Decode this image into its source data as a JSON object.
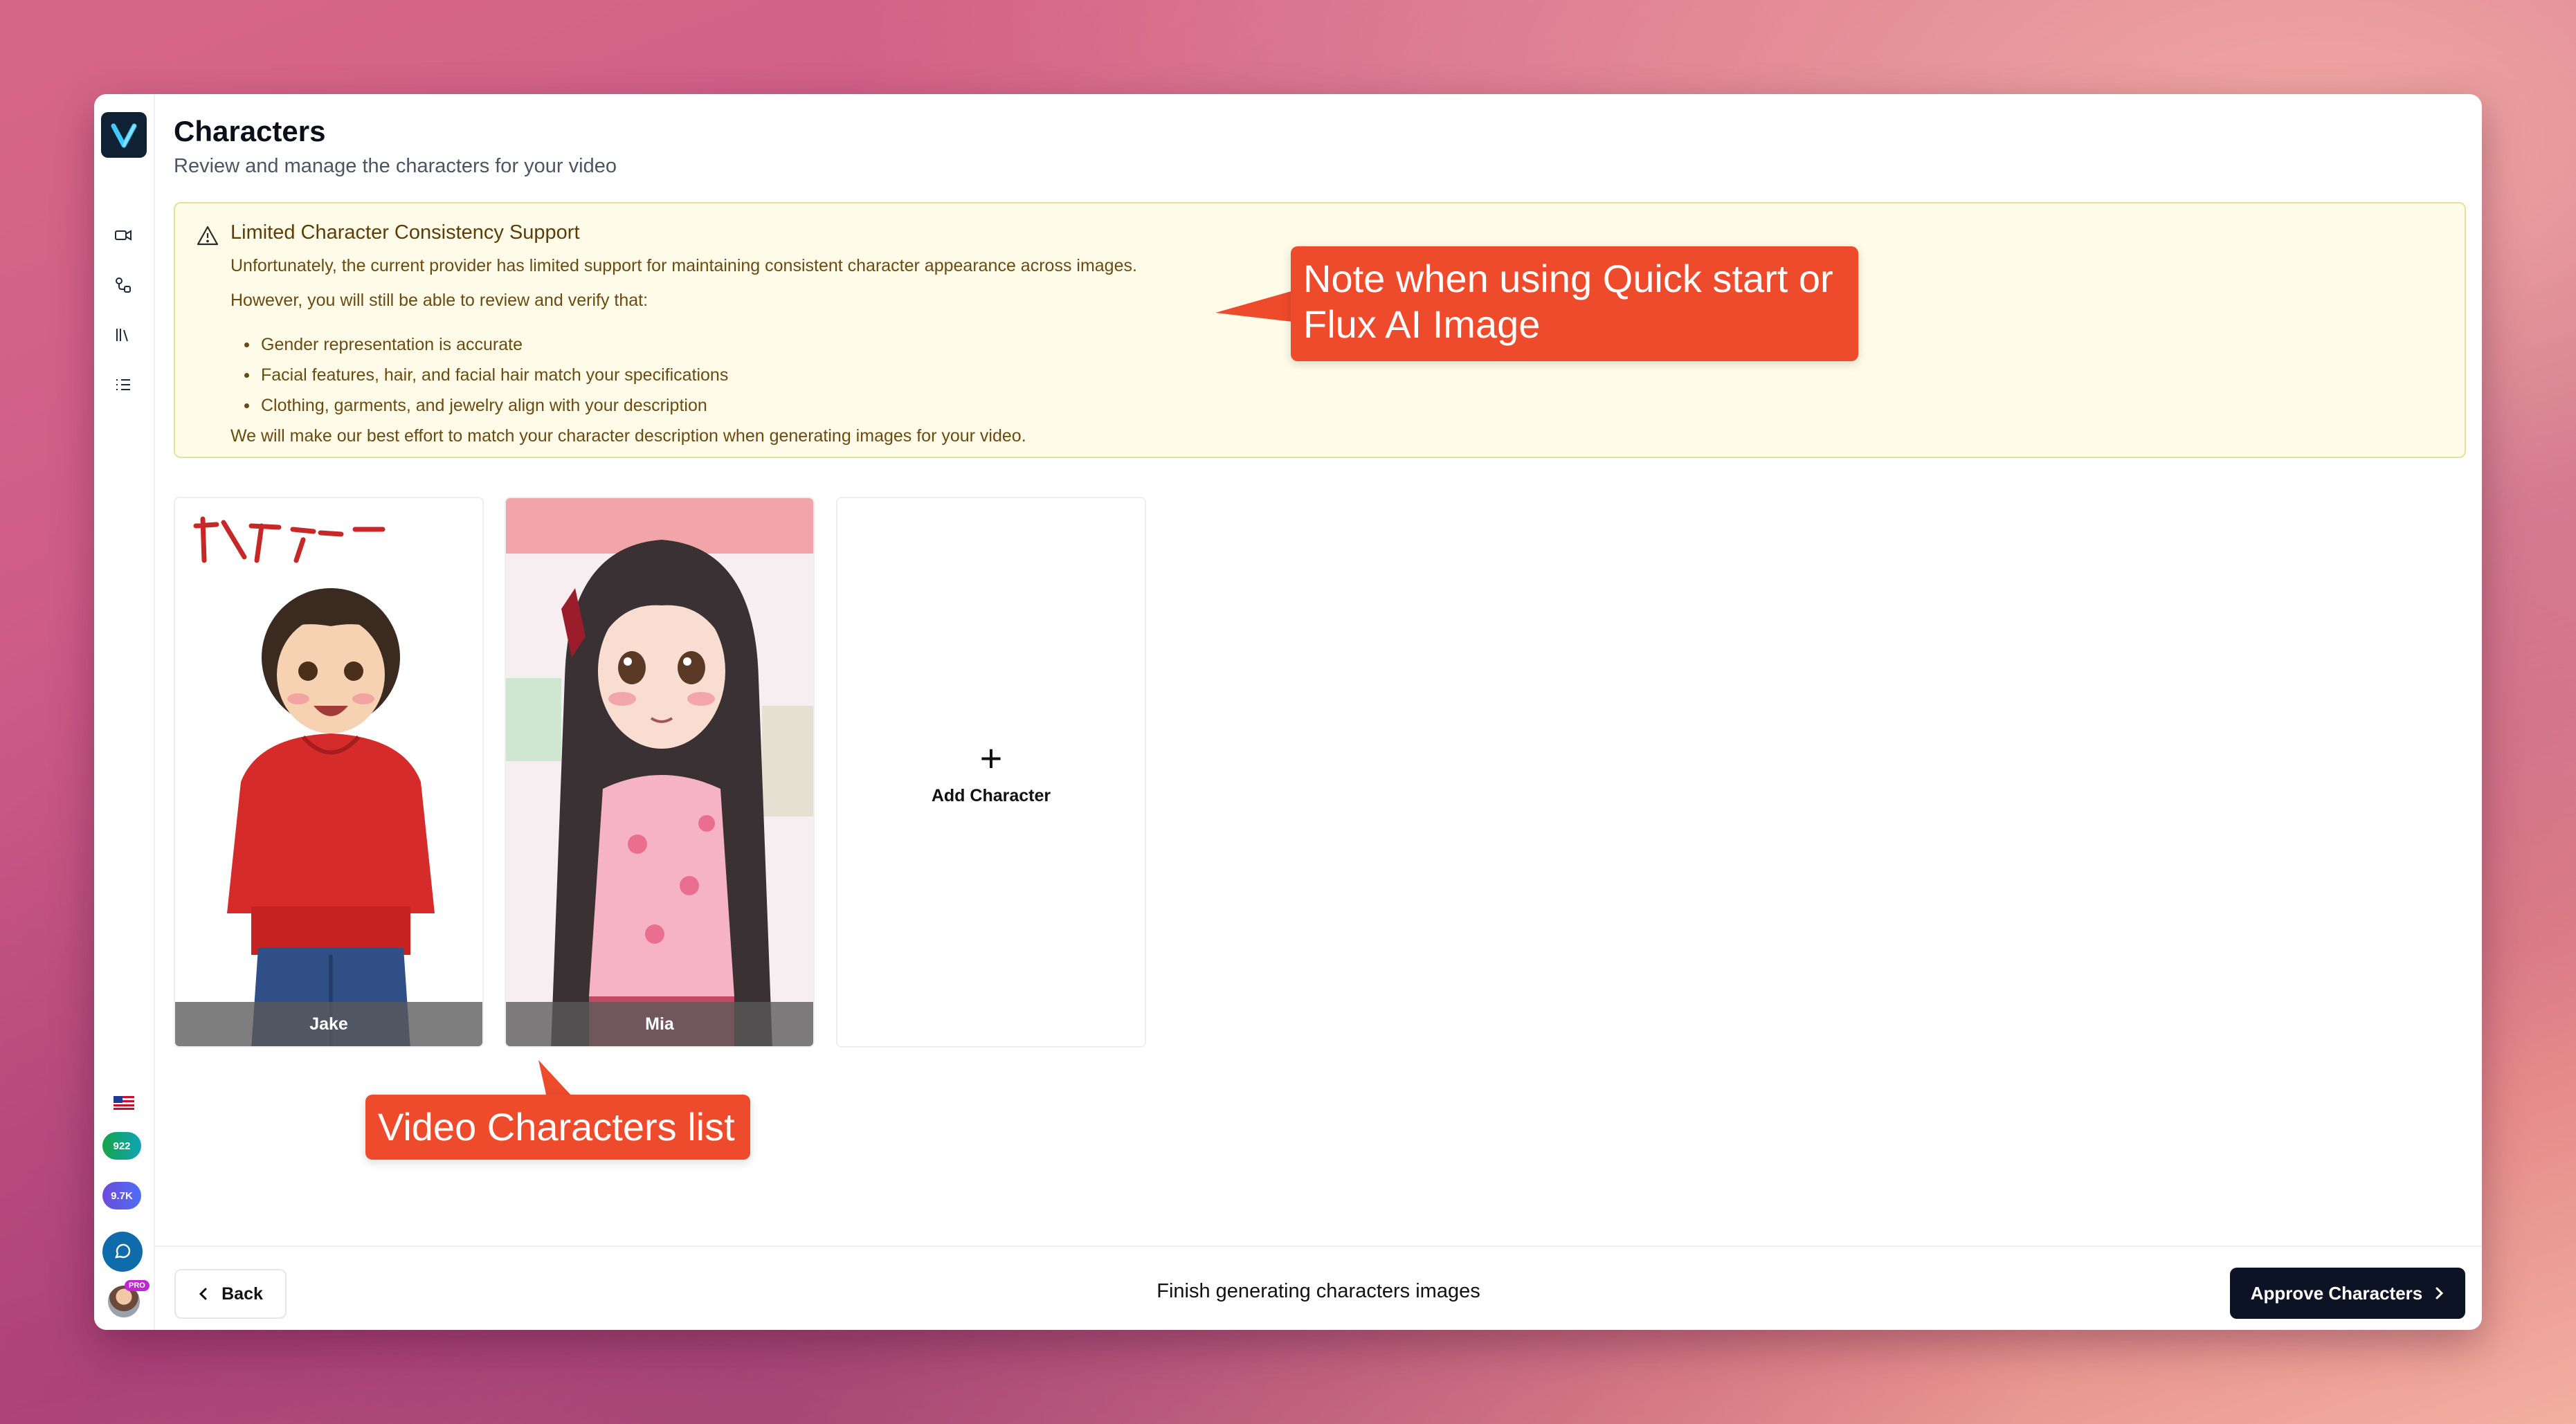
{
  "header": {
    "title": "Characters",
    "subtitle": "Review and manage the characters for your video"
  },
  "sidebar": {
    "items": [
      {
        "name": "video-icon"
      },
      {
        "name": "workflow-icon"
      },
      {
        "name": "library-icon"
      },
      {
        "name": "list-icon"
      }
    ],
    "credits_1": "922",
    "credits_2": "9.7K",
    "pro_label": "PRO"
  },
  "alert": {
    "title": "Limited Character Consistency Support",
    "line1": "Unfortunately, the current provider has limited support for maintaining consistent character appearance across images.",
    "line2": "However, you will still be able to review and verify that:",
    "bullets": [
      "Gender representation is accurate",
      "Facial features, hair, and facial hair match your specifications",
      "Clothing, garments, and jewelry align with your description"
    ],
    "line3": "We will make our best effort to match your character description when generating images for your video."
  },
  "characters": [
    {
      "name": "Jake"
    },
    {
      "name": "Mia"
    }
  ],
  "add_character_label": "Add Character",
  "footer": {
    "back_label": "Back",
    "status": "Finish generating characters images",
    "approve_label": "Approve Characters"
  },
  "callouts": {
    "note_line1": "Note when using Quick start or",
    "note_line2": "Flux AI Image",
    "list_label": "Video Characters list"
  },
  "colors": {
    "callout": "#ee4a2c",
    "alert_bg": "#fefce8",
    "primary_button": "#0b1324"
  }
}
